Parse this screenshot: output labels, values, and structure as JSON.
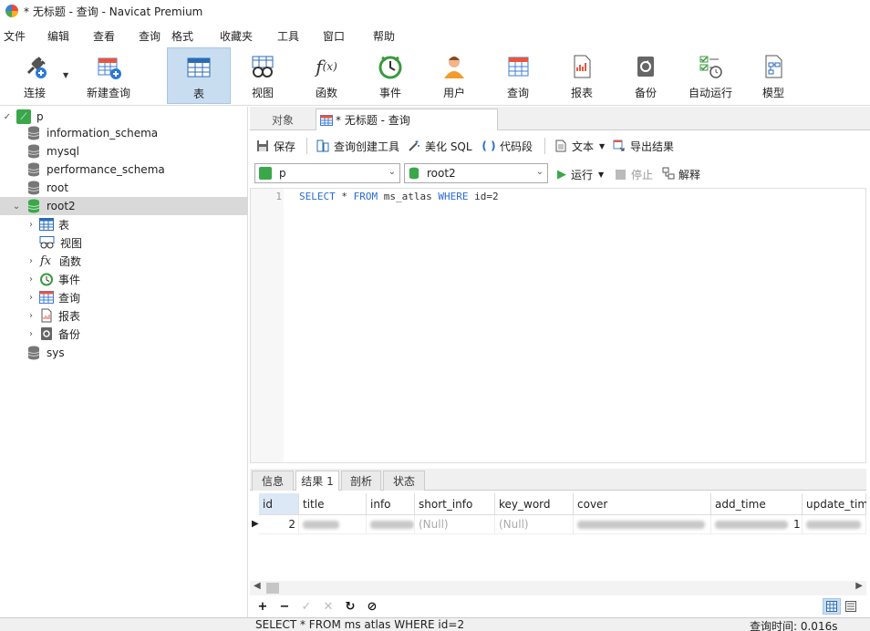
{
  "window": {
    "title": "* 无标题 - 查询 - Navicat Premium"
  },
  "menu": [
    "文件",
    "编辑",
    "查看",
    "查询",
    "格式",
    "收藏夹",
    "工具",
    "窗口",
    "帮助"
  ],
  "toolbar": {
    "items": [
      {
        "label": "连接",
        "icon": "plug-icon"
      },
      {
        "label": "新建查询",
        "icon": "new-query-icon"
      },
      {
        "label": "表",
        "icon": "table-icon"
      },
      {
        "label": "视图",
        "icon": "view-icon"
      },
      {
        "label": "函数",
        "icon": "function-icon"
      },
      {
        "label": "事件",
        "icon": "clock-icon"
      },
      {
        "label": "用户",
        "icon": "user-icon"
      },
      {
        "label": "查询",
        "icon": "query-icon"
      },
      {
        "label": "报表",
        "icon": "report-icon"
      },
      {
        "label": "备份",
        "icon": "backup-icon"
      },
      {
        "label": "自动运行",
        "icon": "schedule-icon"
      },
      {
        "label": "模型",
        "icon": "model-icon"
      }
    ],
    "active_index": 2
  },
  "sidebar": {
    "connection": "p",
    "databases": [
      "information_schema",
      "mysql",
      "performance_schema",
      "root",
      "root2"
    ],
    "root2_children": [
      "表",
      "视图",
      "函数",
      "事件",
      "查询",
      "报表",
      "备份"
    ],
    "last": "sys"
  },
  "tabs": {
    "objects": "对象",
    "query": "* 无标题 - 查询"
  },
  "query_toolbar": {
    "save": "保存",
    "builder": "查询创建工具",
    "beautify": "美化 SQL",
    "snippet": "代码段",
    "text": "文本",
    "export": "导出结果"
  },
  "selectors": {
    "connection": "p",
    "database": "root2",
    "run": "运行",
    "stop": "停止",
    "explain": "解释"
  },
  "editor": {
    "line_no": "1",
    "kw_select": "SELECT",
    "star": " * ",
    "kw_from": "FROM",
    "table": " ms_atlas ",
    "kw_where": "WHERE",
    "cond": " id=2"
  },
  "result_tabs": [
    "信息",
    "结果 1",
    "剖析",
    "状态"
  ],
  "grid": {
    "columns": [
      "id",
      "title",
      "info",
      "short_info",
      "key_word",
      "cover",
      "add_time",
      "update_tim"
    ],
    "row": {
      "id": "2",
      "short_info": "(Null)",
      "key_word": "(Null)",
      "add_time_tail": "1"
    }
  },
  "status": {
    "sql": "SELECT * FROM ms atlas WHERE id=2",
    "time": "查询时间: 0.016s"
  }
}
